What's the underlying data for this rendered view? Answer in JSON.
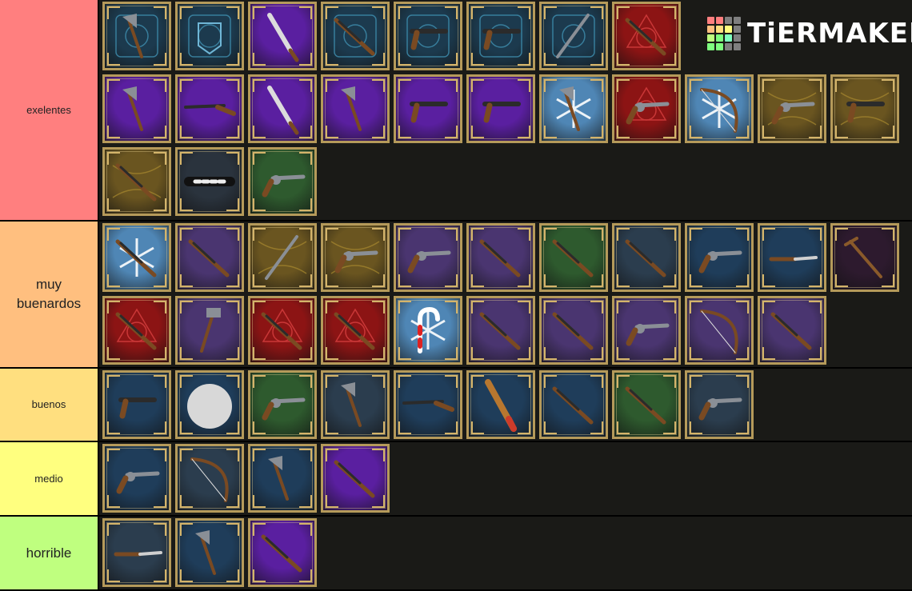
{
  "app": {
    "logo_text": "TiERMAKER"
  },
  "logo_colors": [
    "#ff7f7f",
    "#ff7f7f",
    "#7f7f7f",
    "#7f7f7f",
    "#ffbf7f",
    "#ffdf7f",
    "#ffff7f",
    "#7f7f7f",
    "#bfff7f",
    "#7fff7f",
    "#7fffbf",
    "#7f7f7f",
    "#7fff7f",
    "#7fff7f",
    "#7f7f7f",
    "#7f7f7f"
  ],
  "tiers": [
    {
      "label": "exelentes",
      "color": "#ff7f7f",
      "font": "small",
      "items": [
        {
          "bg": "blue",
          "icon": "axe-icon"
        },
        {
          "bg": "blue",
          "icon": "hexagon-emblem-icon"
        },
        {
          "bg": "purple",
          "icon": "sword-icon"
        },
        {
          "bg": "blue",
          "icon": "rifle-icon"
        },
        {
          "bg": "blue",
          "icon": "pistol-icon"
        },
        {
          "bg": "blue",
          "icon": "pistol-icon"
        },
        {
          "bg": "blue",
          "icon": "spear-icon"
        },
        {
          "bg": "red",
          "icon": "rifle-icon"
        },
        {
          "bg": "purple",
          "icon": "axe-icon"
        },
        {
          "bg": "purple",
          "icon": "shotgun-icon"
        },
        {
          "bg": "purple",
          "icon": "machete-icon"
        },
        {
          "bg": "purple",
          "icon": "axe-icon"
        },
        {
          "bg": "purple",
          "icon": "pistol-icon"
        },
        {
          "bg": "purple",
          "icon": "pistol-icon"
        },
        {
          "bg": "ice",
          "icon": "axe-icon"
        },
        {
          "bg": "red",
          "icon": "revolver-icon"
        },
        {
          "bg": "ice",
          "icon": "bow-icon"
        },
        {
          "bg": "gold",
          "icon": "revolver-icon"
        },
        {
          "bg": "gold",
          "icon": "pistol-icon"
        },
        {
          "bg": "gold",
          "icon": "rifle-icon"
        },
        {
          "bg": "dark",
          "icon": "flashlight-icon"
        },
        {
          "bg": "green",
          "icon": "revolver-icon"
        }
      ]
    },
    {
      "label": "muy buenardos",
      "color": "#ffbf7f",
      "font": "large",
      "items": [
        {
          "bg": "ice",
          "icon": "rifle-icon"
        },
        {
          "bg": "violet",
          "icon": "rifle-icon"
        },
        {
          "bg": "gold",
          "icon": "spear-icon"
        },
        {
          "bg": "gold",
          "icon": "revolver-icon"
        },
        {
          "bg": "violet",
          "icon": "revolver-icon"
        },
        {
          "bg": "violet",
          "icon": "rifle-icon"
        },
        {
          "bg": "green",
          "icon": "rifle-icon"
        },
        {
          "bg": "slate",
          "icon": "rifle-icon"
        },
        {
          "bg": "blue2",
          "icon": "revolver-icon"
        },
        {
          "bg": "blue2",
          "icon": "knife-icon"
        },
        {
          "bg": "plum",
          "icon": "cane-icon"
        },
        {
          "bg": "red",
          "icon": "rifle-icon"
        },
        {
          "bg": "violet",
          "icon": "hammer-icon"
        },
        {
          "bg": "red",
          "icon": "rifle-icon"
        },
        {
          "bg": "red",
          "icon": "rifle-icon"
        },
        {
          "bg": "ice",
          "icon": "candy-cane-icon"
        },
        {
          "bg": "violet",
          "icon": "rifle-icon"
        },
        {
          "bg": "violet",
          "icon": "rifle-icon"
        },
        {
          "bg": "violet",
          "icon": "revolver-icon"
        },
        {
          "bg": "violet",
          "icon": "bow-icon"
        },
        {
          "bg": "violet",
          "icon": "rifle-icon"
        }
      ]
    },
    {
      "label": "buenos",
      "color": "#ffdf7f",
      "font": "small",
      "items": [
        {
          "bg": "blue2",
          "icon": "pistol-icon"
        },
        {
          "bg": "blue2",
          "icon": "rock-icon"
        },
        {
          "bg": "green",
          "icon": "revolver-icon"
        },
        {
          "bg": "slate",
          "icon": "tomahawk-icon"
        },
        {
          "bg": "blue2",
          "icon": "shotgun-icon"
        },
        {
          "bg": "blue2",
          "icon": "bat-icon"
        },
        {
          "bg": "blue2",
          "icon": "rifle-icon"
        },
        {
          "bg": "green",
          "icon": "rifle-icon"
        },
        {
          "bg": "slate",
          "icon": "revolver-icon"
        }
      ]
    },
    {
      "label": "medio",
      "color": "#ffff7f",
      "font": "small",
      "items": [
        {
          "bg": "blue2",
          "icon": "revolver-icon"
        },
        {
          "bg": "slate",
          "icon": "bow-icon"
        },
        {
          "bg": "blue2",
          "icon": "hatchet-icon"
        },
        {
          "bg": "purple",
          "icon": "rifle-icon"
        }
      ]
    },
    {
      "label": "horrible",
      "color": "#bfff7f",
      "font": "large",
      "items": [
        {
          "bg": "slate",
          "icon": "knife-icon"
        },
        {
          "bg": "blue2",
          "icon": "axe-icon"
        },
        {
          "bg": "purple",
          "icon": "rifle-icon"
        }
      ]
    }
  ],
  "palette": {
    "blue": "#1c3a4e",
    "purple": "#5a1fa0",
    "red": "#8c1414",
    "ice": "#4f86b5",
    "gold": "#6a5520",
    "dark": "#2a333d",
    "green": "#2e5a2e",
    "violet": "#4a3570",
    "slate": "#2b3d4e",
    "blue2": "#1f3d5a",
    "plum": "#2d1a2e"
  }
}
